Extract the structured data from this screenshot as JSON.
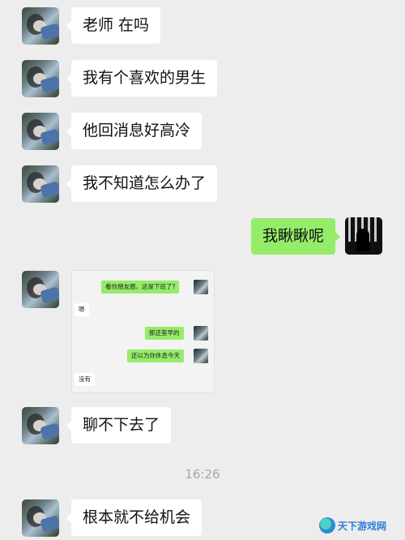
{
  "messages": [
    {
      "text": "老师 在吗"
    },
    {
      "text": "我有个喜欢的男生"
    },
    {
      "text": "他回消息好高冷"
    },
    {
      "text": "我不知道怎么办了"
    },
    {
      "text": "我瞅瞅呢"
    },
    {
      "text": "聊不下去了"
    },
    {
      "text": "根本就不给机会"
    }
  ],
  "embedded_chat": {
    "messages": [
      {
        "text": "看你朋友圈，这是下班了?"
      },
      {
        "text": "嗯"
      },
      {
        "text": "那还蛮早的"
      },
      {
        "text": "还以为你休息今天"
      },
      {
        "text": "没有"
      }
    ]
  },
  "timestamp": "16:26",
  "watermark": {
    "text": "天下游戏网"
  },
  "colors": {
    "background": "#ededed",
    "incoming_bubble": "#ffffff",
    "outgoing_bubble": "#95ec69"
  }
}
